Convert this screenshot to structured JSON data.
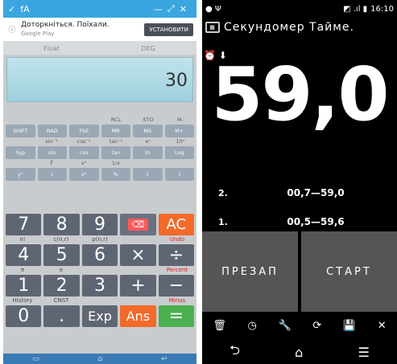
{
  "left": {
    "status": {
      "a": "✓",
      "b": "fA",
      "c": "—",
      "d": "⤢",
      "e": "✕"
    },
    "ad": {
      "line1": "Доторкніться. Поїхали.",
      "line2": "Google Play",
      "button": "УСТАНОВИТИ"
    },
    "mode": {
      "a": "Float",
      "b": "DEG"
    },
    "display_value": "30",
    "sci_labels_1": [
      "",
      "",
      "",
      "RCL",
      "STO",
      "M-"
    ],
    "sci_row_1": [
      "SHIFT",
      "RAD",
      "FSE",
      "MR",
      "MS",
      "M+"
    ],
    "sci_labels_2": [
      "",
      "sin⁻¹",
      "cos⁻¹",
      "tan⁻¹",
      "eˣ",
      "10ˣ"
    ],
    "sci_row_2": [
      "hyp",
      "sin",
      "cos",
      "tan",
      "ln",
      "Log"
    ],
    "sci_labels_3": [
      "",
      "∛",
      "x³",
      "1/x",
      "",
      ""
    ],
    "sci_row_3": [
      "yˣ",
      "√",
      "x²",
      "%",
      "(",
      ")"
    ],
    "num_row_1": [
      "7",
      "8",
      "9",
      "⌫",
      "AC"
    ],
    "num_labels_1": [
      "n!",
      "c(n,r)",
      "p(n,r)",
      "",
      "Undo"
    ],
    "num_row_2": [
      "4",
      "5",
      "6",
      "×",
      "÷"
    ],
    "num_labels_2": [
      "π",
      "e",
      "",
      "",
      "Percent"
    ],
    "num_row_3": [
      "1",
      "2",
      "3",
      "+",
      "−"
    ],
    "num_labels_3": [
      "History",
      "CNST",
      "",
      "",
      "Minus"
    ],
    "num_row_4": [
      "0",
      ".",
      "Exp",
      "Ans",
      "="
    ],
    "nav": {
      "back": "▭",
      "home": "⌂",
      "recent": "↩"
    }
  },
  "right": {
    "status": {
      "left": "● Ψ",
      "icons": "◩ .ıl ▮",
      "time": "16:10"
    },
    "title": "Секундомер Тайме.",
    "app_icon": "▦",
    "top_icons": "⏰ ⬇",
    "big_time": "59,0",
    "laps": [
      {
        "n": "2.",
        "t": "00,7—59,0"
      },
      {
        "n": "1.",
        "t": "00,5—59,6"
      }
    ],
    "button_left": "ПРЕЗАП",
    "button_right": "СТАРТ",
    "tools": [
      "🗑",
      "◷",
      "🔧",
      "⟳",
      "💾",
      "✕"
    ],
    "nav": {
      "back": "⮌",
      "home": "⌂",
      "menu": "☰"
    }
  }
}
